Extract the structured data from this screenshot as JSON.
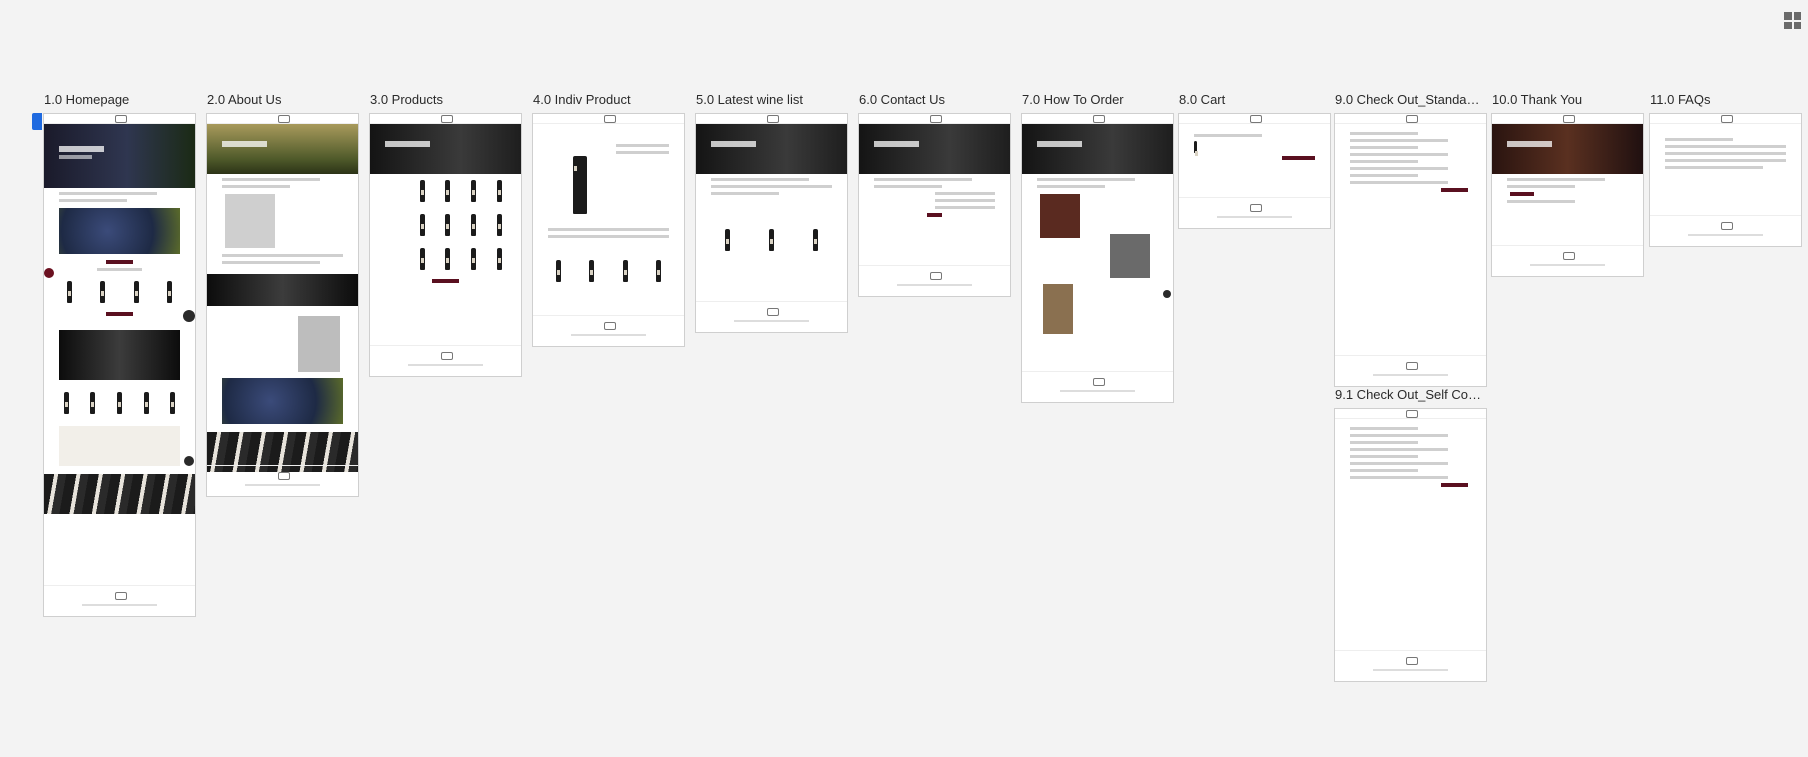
{
  "toolbar": {
    "grid_icon": "grid-view-icon"
  },
  "artboards": [
    {
      "id": "home",
      "label": "1.0 Homepage"
    },
    {
      "id": "about",
      "label": "2.0 About Us"
    },
    {
      "id": "products",
      "label": "3.0 Products"
    },
    {
      "id": "indiv",
      "label": "4.0 Indiv Product"
    },
    {
      "id": "latest",
      "label": "5.0 Latest wine list"
    },
    {
      "id": "contact",
      "label": "6.0 Contact Us"
    },
    {
      "id": "howto",
      "label": "7.0 How To Order"
    },
    {
      "id": "cart",
      "label": "8.0 Cart"
    },
    {
      "id": "checkout_std",
      "label": "9.0 Check Out_Standard ..."
    },
    {
      "id": "thankyou",
      "label": "10.0 Thank You"
    },
    {
      "id": "faqs",
      "label": "11.0 FAQs"
    },
    {
      "id": "checkout_self",
      "label": "9.1 Check Out_Self Collec..."
    }
  ],
  "colors": {
    "canvas": "#f3f3f3",
    "accent": "#5a1020",
    "gold": "#c9ad6a",
    "selection": "#1f6ae0"
  }
}
